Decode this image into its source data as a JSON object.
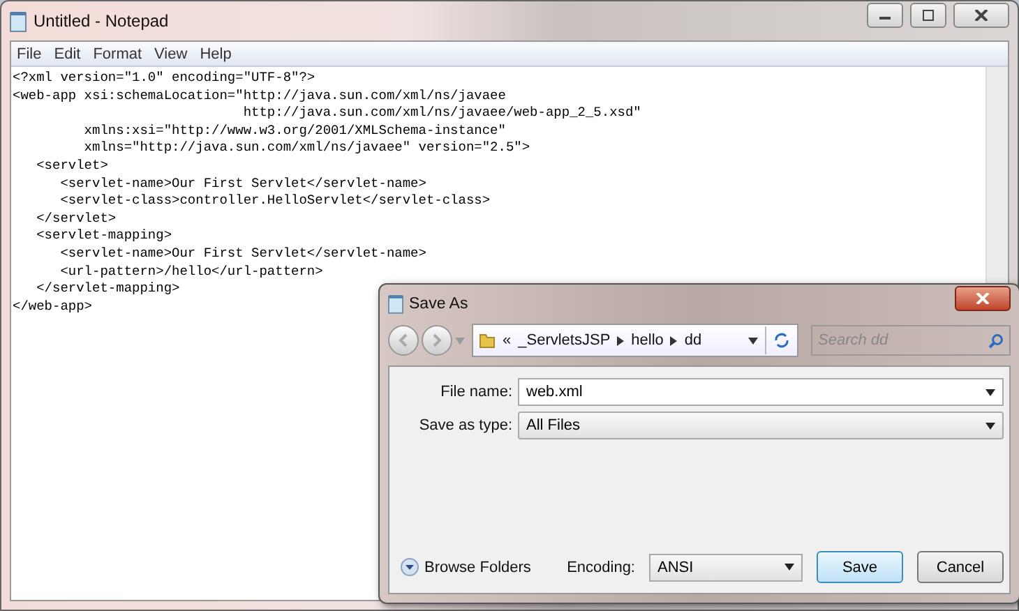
{
  "window": {
    "title": "Untitled - Notepad"
  },
  "menu": [
    "File",
    "Edit",
    "Format",
    "View",
    "Help"
  ],
  "editor": {
    "lines": [
      "<?xml version=\"1.0\" encoding=\"UTF-8\"?>",
      "<web-app xsi:schemaLocation=\"http://java.sun.com/xml/ns/javaee",
      "                             http://java.sun.com/xml/ns/javaee/web-app_2_5.xsd\"",
      "         xmlns:xsi=\"http://www.w3.org/2001/XMLSchema-instance\"",
      "         xmlns=\"http://java.sun.com/xml/ns/javaee\" version=\"2.5\">",
      "   <servlet>",
      "      <servlet-name>Our First Servlet</servlet-name>",
      "      <servlet-class>controller.HelloServlet</servlet-class>",
      "   </servlet>",
      "   <servlet-mapping>",
      "      <servlet-name>Our First Servlet</servlet-name>",
      "      <url-pattern>/hello</url-pattern>",
      "   </servlet-mapping>",
      "</web-app>"
    ]
  },
  "dialog": {
    "title": "Save As",
    "breadcrumb": [
      "«",
      "_ServletsJSP",
      "hello",
      "dd"
    ],
    "search": {
      "placeholder": "Search dd"
    },
    "fields": [
      {
        "label": "File name:",
        "value": "web.xml",
        "kind": "combo"
      },
      {
        "label": "Save as type:",
        "value": "All Files",
        "kind": "select"
      }
    ],
    "browse_folders": "Browse Folders",
    "encoding": {
      "label": "Encoding:",
      "value": "ANSI"
    },
    "buttons": [
      "Save",
      "Cancel"
    ]
  }
}
